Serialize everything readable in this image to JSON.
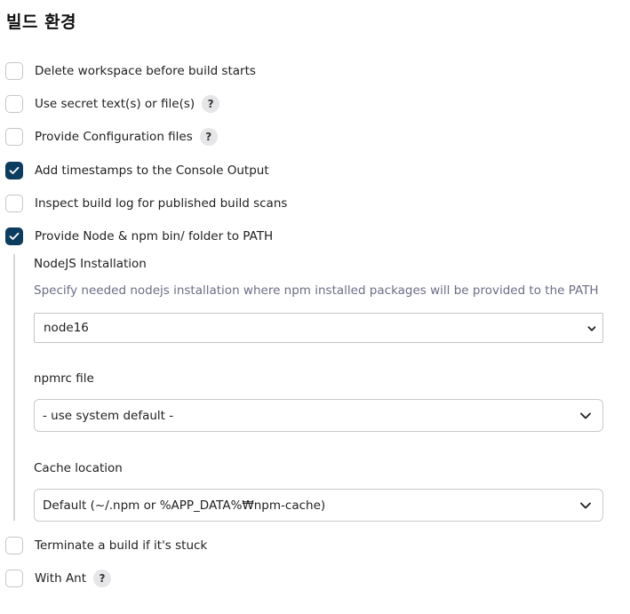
{
  "section": {
    "title": "빌드 환경"
  },
  "options": {
    "delete_workspace": {
      "label": "Delete workspace before build starts",
      "checked": false
    },
    "secret_text": {
      "label": "Use secret text(s) or file(s)",
      "checked": false,
      "help": "?"
    },
    "config_files": {
      "label": "Provide Configuration files",
      "checked": false,
      "help": "?"
    },
    "timestamps": {
      "label": "Add timestamps to the Console Output",
      "checked": true
    },
    "inspect_log": {
      "label": "Inspect build log for published build scans",
      "checked": false
    },
    "node_npm": {
      "label": "Provide Node & npm bin/ folder to PATH",
      "checked": true
    },
    "terminate_stuck": {
      "label": "Terminate a build if it's stuck",
      "checked": false
    },
    "with_ant": {
      "label": "With Ant",
      "checked": false,
      "help": "?"
    }
  },
  "nodejs": {
    "installation_label": "NodeJS Installation",
    "installation_desc": "Specify needed nodejs installation where npm installed packages will be provided to the PATH",
    "installation_value": "node16",
    "npmrc_label": "npmrc file",
    "npmrc_value": "- use system default -",
    "cache_label": "Cache location",
    "cache_value": "Default (~/.npm or %APP_DATA%₩npm-cache)"
  },
  "colors": {
    "checkbox_checked": "#0d3d5e",
    "description_text": "#6c6d87"
  }
}
